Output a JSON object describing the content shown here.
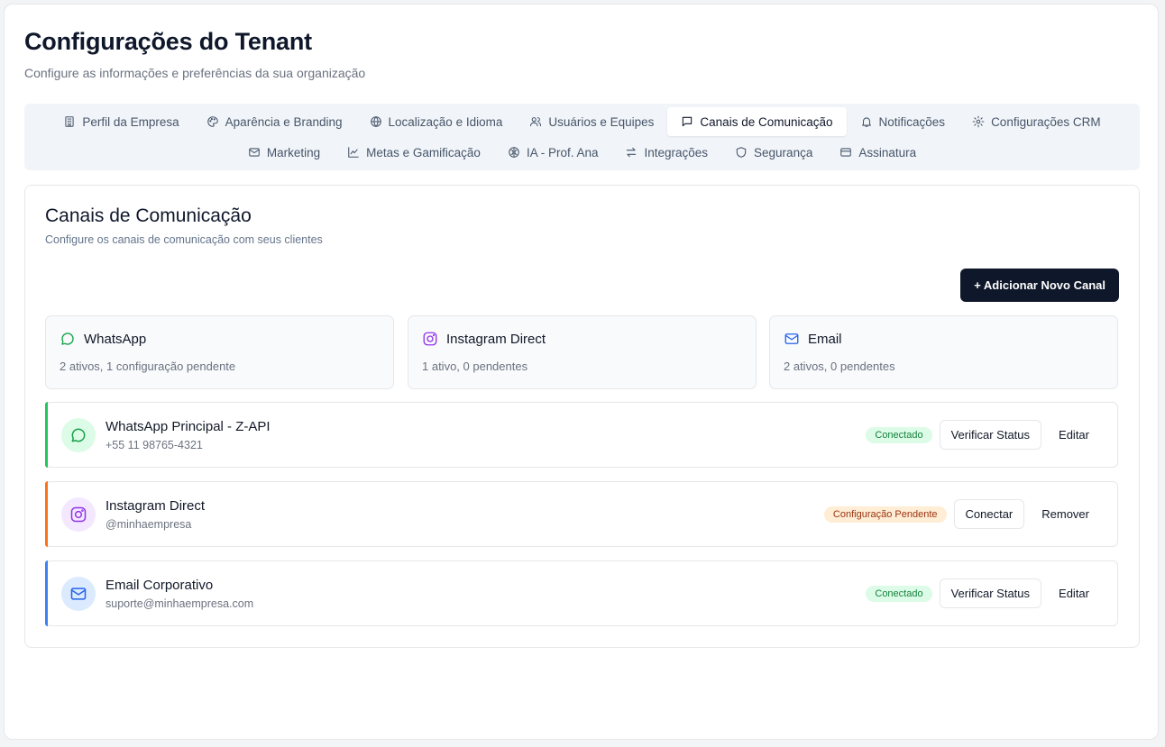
{
  "page": {
    "title": "Configurações do Tenant",
    "subtitle": "Configure as informações e preferências da sua organização"
  },
  "tabs": {
    "row1": [
      {
        "label": "Perfil da Empresa",
        "icon": "building-icon"
      },
      {
        "label": "Aparência e Branding",
        "icon": "palette-icon"
      },
      {
        "label": "Localização e Idioma",
        "icon": "globe-icon"
      },
      {
        "label": "Usuários e Equipes",
        "icon": "users-icon"
      },
      {
        "label": "Canais de Comunicação",
        "icon": "message-square-icon",
        "active": true
      },
      {
        "label": "Notificações",
        "icon": "bell-icon"
      },
      {
        "label": "Configurações CRM",
        "icon": "gear-icon"
      }
    ],
    "row2": [
      {
        "label": "Marketing",
        "icon": "mail-icon"
      },
      {
        "label": "Metas e Gamificação",
        "icon": "chart-line-icon"
      },
      {
        "label": "IA - Prof. Ana",
        "icon": "brain-icon"
      },
      {
        "label": "Integrações",
        "icon": "arrows-exchange-icon"
      },
      {
        "label": "Segurança",
        "icon": "shield-icon"
      },
      {
        "label": "Assinatura",
        "icon": "credit-card-icon"
      }
    ]
  },
  "section": {
    "title": "Canais de Comunicação",
    "subtitle": "Configure os canais de comunicação com seus clientes",
    "add_button": "+ Adicionar Novo Canal"
  },
  "summaries": [
    {
      "name": "WhatsApp",
      "desc": "2 ativos, 1 configuração pendente",
      "icon": "whatsapp-icon",
      "color": "#16a34a"
    },
    {
      "name": "Instagram Direct",
      "desc": "1 ativo, 0 pendentes",
      "icon": "instagram-icon",
      "color": "#9333ea"
    },
    {
      "name": "Email",
      "desc": "2 ativos, 0 pendentes",
      "icon": "mail-icon",
      "color": "#2563eb"
    }
  ],
  "channels": [
    {
      "name": "WhatsApp Principal - Z-API",
      "detail": "+55 11 98765-4321",
      "status": "Conectado",
      "primary_action": "Verificar Status",
      "secondary_action": "Editar",
      "accent": "#22c55e",
      "icon": "whatsapp-icon"
    },
    {
      "name": "Instagram Direct",
      "detail": "@minhaempresa",
      "status": "Configuração Pendente",
      "primary_action": "Conectar",
      "secondary_action": "Remover",
      "accent": "#f97316",
      "icon": "instagram-icon"
    },
    {
      "name": "Email Corporativo",
      "detail": "suporte@minhaempresa.com",
      "status": "Conectado",
      "primary_action": "Verificar Status",
      "secondary_action": "Editar",
      "accent": "#3b82f6",
      "icon": "mail-icon"
    }
  ]
}
